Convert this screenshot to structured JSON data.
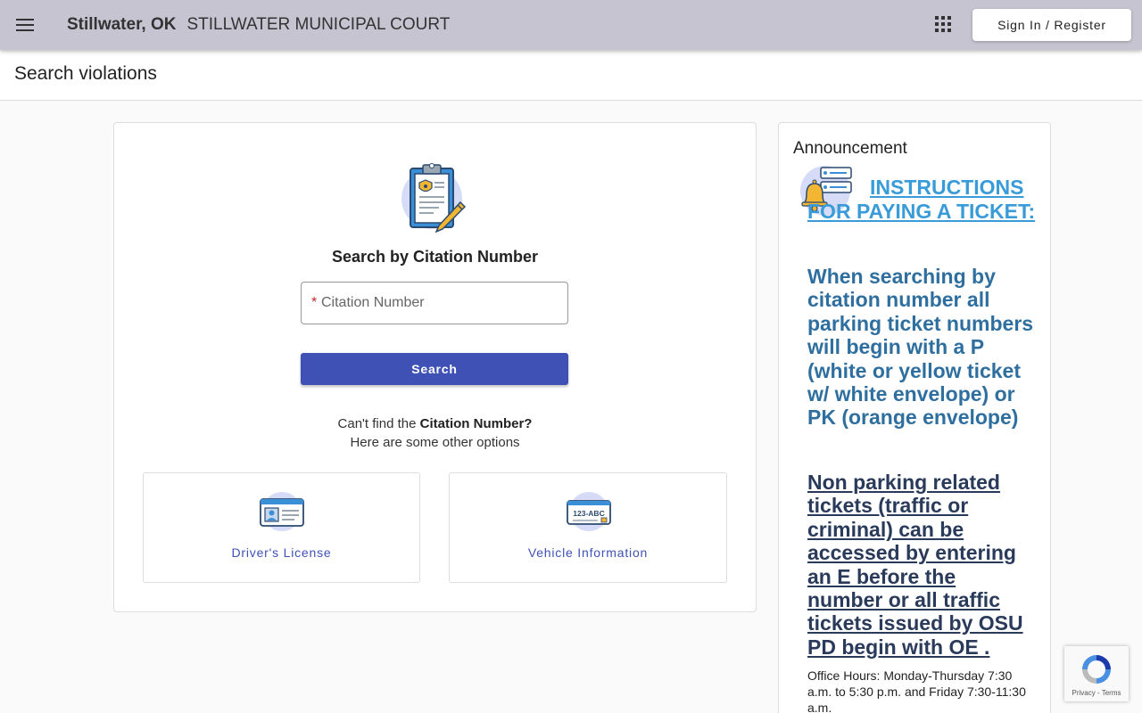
{
  "header": {
    "city": "Stillwater, OK",
    "court": "STILLWATER MUNICIPAL COURT",
    "signin_label": "Sign In / Register"
  },
  "page": {
    "title": "Search violations"
  },
  "search": {
    "heading": "Search by Citation Number",
    "placeholder": "Citation Number",
    "required_mark": "*",
    "button_label": "Search",
    "cant_find_prefix": "Can't find the ",
    "cant_find_bold": "Citation Number?",
    "other_options": "Here are some other options",
    "options": [
      {
        "label": "Driver's License",
        "icon": "drivers-license-icon"
      },
      {
        "label": "Vehicle Information",
        "icon": "license-plate-icon",
        "plate_text": "123-ABC"
      }
    ]
  },
  "announcement": {
    "title": "Announcement",
    "link_text": "INSTRUCTIONS FOR PAYING A TICKET:",
    "paragraph1": "When searching by citation number all parking ticket numbers will begin with a P (white or yellow ticket w/ white envelope)  or PK (orange envelope)",
    "paragraph2": "Non parking related tickets (traffic or criminal) can be accessed by entering an E before the number or all traffic tickets issued by OSU PD begin with OE .",
    "office_hours": "Office Hours:  Monday-Thursday 7:30 a.m. to 5:30 p.m. and Friday 7:30-11:30 a.m."
  },
  "recaptcha": {
    "legal": "Privacy - Terms"
  },
  "colors": {
    "primary": "#3f51b5",
    "topbar": "#c5c4d0",
    "link": "#3a9bd9",
    "announcement_text": "#2f6f9f",
    "announcement_dark": "#2a3a5a"
  }
}
